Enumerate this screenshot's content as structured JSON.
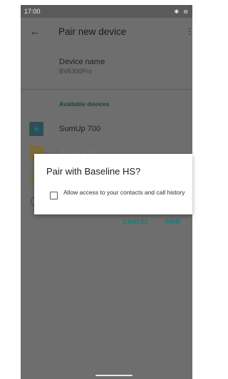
{
  "status_bar": {
    "time": "17:00",
    "icons": "✱ ⊖"
  },
  "app_bar": {
    "title": "Pair new device",
    "back_icon": "←",
    "menu_icon": "⋮"
  },
  "device_name": {
    "title": "Device name",
    "value": "BV6300Pro"
  },
  "available_devices": {
    "header": "Available devices",
    "items": [
      {
        "label": "SumUp 700",
        "icon": "bluetooth-icon"
      },
      {
        "label": "Baseline HS",
        "icon": "headset-icon"
      }
    ]
  },
  "dialog": {
    "title": "Pair with Baseline HS?",
    "checkbox_label": "Allow access to your contacts and call history",
    "checked": false,
    "cancel_label": "CANCEL",
    "pair_label": "PAIR"
  },
  "colors": {
    "accent": "#0d7f76",
    "scrim": "#6e6e6e"
  }
}
